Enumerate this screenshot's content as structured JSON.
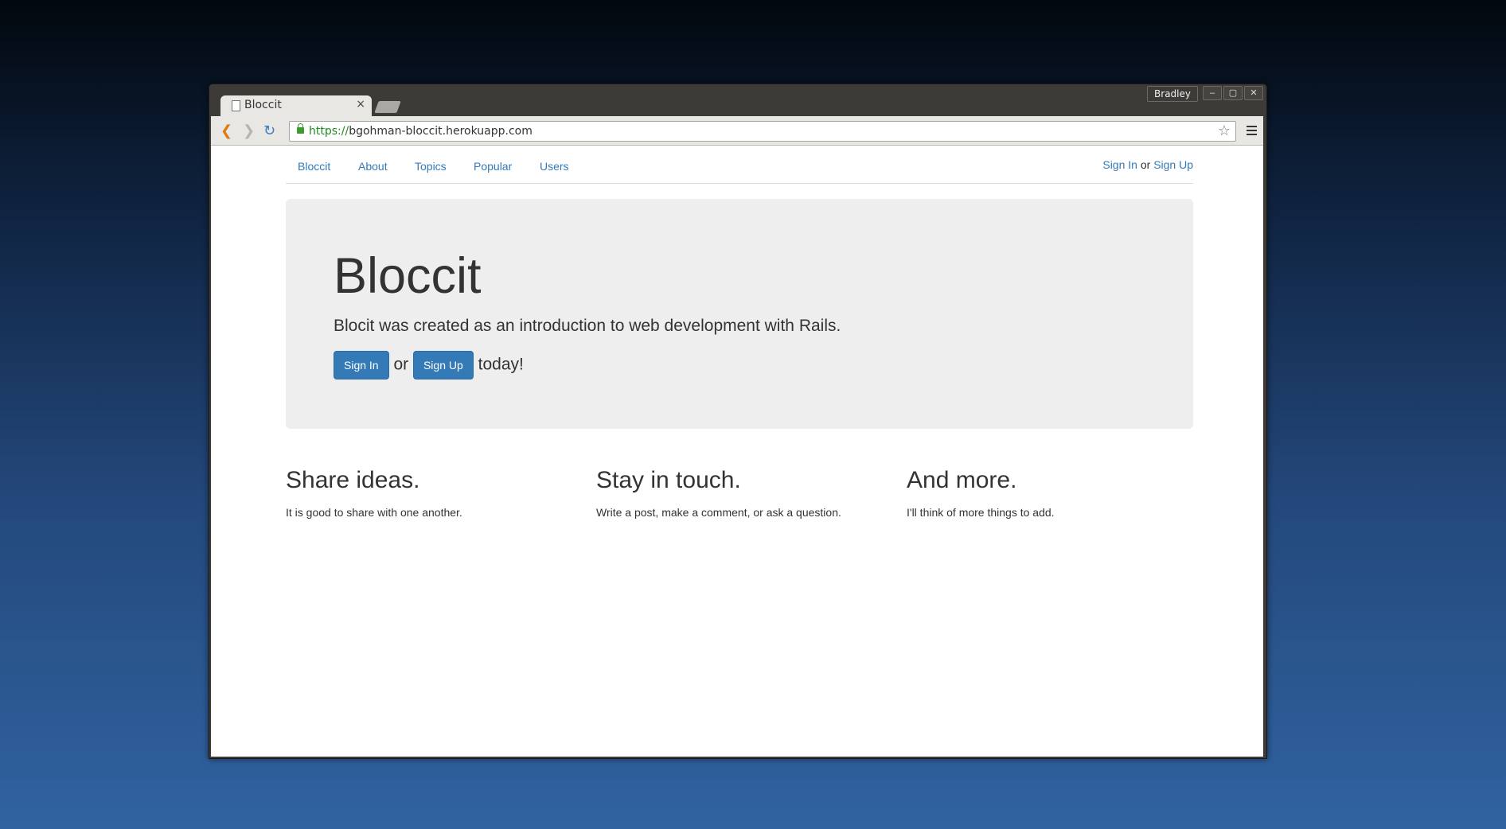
{
  "browser": {
    "tab_title": "Bloccit",
    "tab_close": "×",
    "profile_name": "Bradley",
    "window_controls": {
      "minimize": "–",
      "maximize": "▢",
      "close": "✕"
    },
    "url_scheme": "https://",
    "url_host": "bgohman-bloccit.herokuapp.com",
    "icons": {
      "back": "back-arrow-icon",
      "forward": "forward-arrow-icon",
      "reload": "reload-icon",
      "bookmark": "star-icon",
      "menu": "hamburger-menu-icon",
      "lock": "lock-icon"
    }
  },
  "nav": {
    "items": [
      "Bloccit",
      "About",
      "Topics",
      "Popular",
      "Users"
    ],
    "sign_in": "Sign In",
    "or": "or",
    "sign_up": "Sign Up"
  },
  "jumbotron": {
    "title": "Bloccit",
    "lead": "Blocit was created as an introduction to web development with Rails.",
    "sign_in_button": "Sign In",
    "or": "or",
    "sign_up_button": "Sign Up",
    "suffix": "today!"
  },
  "features": [
    {
      "title": "Share ideas.",
      "text": "It is good to share with one another."
    },
    {
      "title": "Stay in touch.",
      "text": "Write a post, make a comment, or ask a question."
    },
    {
      "title": "And more.",
      "text": "I'll think of more things to add."
    }
  ],
  "colors": {
    "link": "#337ab7",
    "button": "#337ab7",
    "jumbotron_bg": "#eeeeee",
    "text": "#333333"
  }
}
